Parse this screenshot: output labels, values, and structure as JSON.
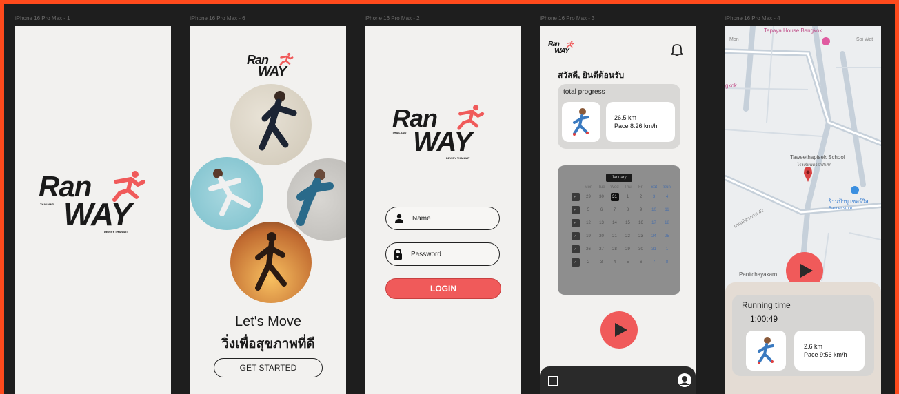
{
  "frames": {
    "f1": {
      "label": "iPhone 16 Pro Max - 1"
    },
    "f2": {
      "label": "iPhone 16 Pro Max - 6"
    },
    "f3": {
      "label": "iPhone 16 Pro Max - 2"
    },
    "f4": {
      "label": "iPhone 16 Pro Max - 3"
    },
    "f5": {
      "label": "iPhone 16 Pro Max - 4"
    }
  },
  "logo": {
    "line1": "Ran",
    "line2": "WAY",
    "region": "THAILAND",
    "credit": "DEV BY THANWIT"
  },
  "onboarding": {
    "headline": "Let's Move",
    "subheadline": "วิ่งเพื่อสุขภาพที่ดี",
    "cta": "GET STARTED"
  },
  "login": {
    "name_placeholder": "Name",
    "password_placeholder": "Password",
    "button": "LOGIN"
  },
  "home": {
    "greeting": "สวัสดี, ยินดีต้อนรับ",
    "progress_title": "total progress",
    "distance": "26.5 km",
    "pace": "Pace 8:26 km/h",
    "month": "January",
    "weekdays": [
      "Mon",
      "Tue",
      "Wed",
      "Thu",
      "Fri",
      "Sat",
      "Sun"
    ],
    "weeks": [
      [
        "29",
        "30",
        "31",
        "1",
        "2",
        "3",
        "4"
      ],
      [
        "5",
        "6",
        "7",
        "8",
        "9",
        "10",
        "11"
      ],
      [
        "12",
        "13",
        "14",
        "15",
        "16",
        "17",
        "18"
      ],
      [
        "19",
        "20",
        "21",
        "22",
        "23",
        "24",
        "25"
      ],
      [
        "26",
        "27",
        "28",
        "29",
        "30",
        "31",
        "1"
      ],
      [
        "2",
        "3",
        "4",
        "5",
        "6",
        "7",
        "8"
      ]
    ],
    "selected_day": "1"
  },
  "map": {
    "place1": "Tapaya House Bangkok",
    "place2": "Taweethapisek School",
    "place2_th": "โรงเรียนทวีธาภิเศก",
    "place3": "ร้านป้าบุ เซอร์วิส",
    "place3_sub": "Banner store",
    "place4": "Panitchayakarn",
    "road": "ถนนอิสรภาพ 42",
    "road2": "Soi Wat",
    "edge1": "gkok",
    "edge2": "Mon",
    "running_title": "Running time",
    "running_time": "1:00:49",
    "distance": "2.6 km",
    "pace": "Pace 9:56 km/h"
  },
  "colors": {
    "accent": "#f05a5a",
    "frame": "#f2f1ef",
    "canvas": "#1e1e1e",
    "border": "#ff4a1c"
  }
}
